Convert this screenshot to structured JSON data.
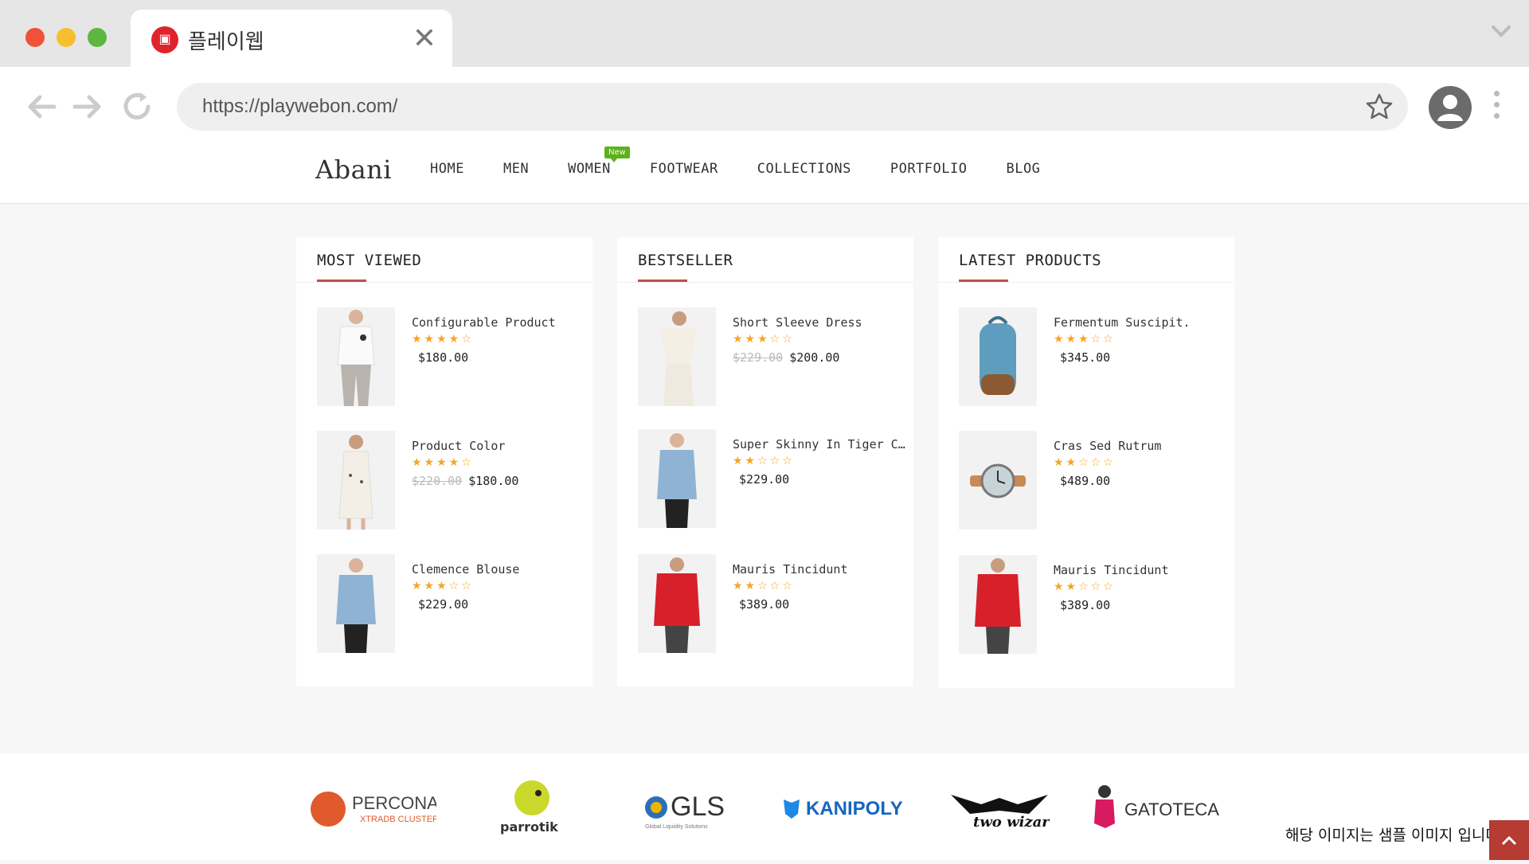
{
  "browser": {
    "tab_title": "플레이웹",
    "url": "https://playwebon.com/"
  },
  "site": {
    "logo": "Abani",
    "nav": [
      {
        "label": "HOME"
      },
      {
        "label": "MEN"
      },
      {
        "label": "WOMEN",
        "badge": "New"
      },
      {
        "label": "FOOTWEAR"
      },
      {
        "label": "COLLECTIONS"
      },
      {
        "label": "PORTFOLIO"
      },
      {
        "label": "BLOG"
      }
    ]
  },
  "panels": [
    {
      "title": "MOST VIEWED",
      "products": [
        {
          "name": "Configurable Product",
          "rating": 4,
          "old_price": "",
          "price": "$180.00",
          "image": "white-shirt-man"
        },
        {
          "name": "Product Color",
          "rating": 4,
          "old_price": "$220.00",
          "price": "$180.00",
          "image": "white-dress-woman"
        },
        {
          "name": "Clemence Blouse",
          "rating": 3,
          "old_price": "",
          "price": "$229.00",
          "image": "denim-jacket-woman"
        }
      ]
    },
    {
      "title": "BESTSELLER",
      "products": [
        {
          "name": "Short Sleeve Dress",
          "rating": 3,
          "old_price": "$229.00",
          "price": "$200.00",
          "image": "white-top-woman"
        },
        {
          "name": "Super Skinny In Tiger C…",
          "rating": 2,
          "old_price": "",
          "price": "$229.00",
          "image": "denim-jacket-woman"
        },
        {
          "name": "Mauris Tincidunt",
          "rating": 2,
          "old_price": "",
          "price": "$389.00",
          "image": "red-jacket-man"
        }
      ]
    },
    {
      "title": "LATEST PRODUCTS",
      "products": [
        {
          "name": "Fermentum Suscipit.",
          "rating": 3,
          "old_price": "",
          "price": "$345.00",
          "image": "blue-backpack"
        },
        {
          "name": "Cras Sed Rutrum",
          "rating": 2,
          "old_price": "",
          "price": "$489.00",
          "image": "wrist-watch"
        },
        {
          "name": "Mauris Tincidunt",
          "rating": 2,
          "old_price": "",
          "price": "$389.00",
          "image": "red-jacket-man"
        }
      ]
    }
  ],
  "brands": [
    {
      "name": "PERCONA",
      "sub": "XTRADB CLUSTER"
    },
    {
      "name": "parrotik",
      "sub": ""
    },
    {
      "name": "GLS",
      "sub": "Global Liquidity Solutions"
    },
    {
      "name": "KANIPOLY",
      "sub": ""
    },
    {
      "name": "two wizards",
      "sub": ""
    },
    {
      "name": "GATOTECA",
      "sub": ""
    }
  ],
  "caption": "해당 이미지는 샘플 이미지 입니다.",
  "colors": {
    "accent": "#c0504d",
    "star": "#f5a623",
    "badge": "#5bb318"
  }
}
